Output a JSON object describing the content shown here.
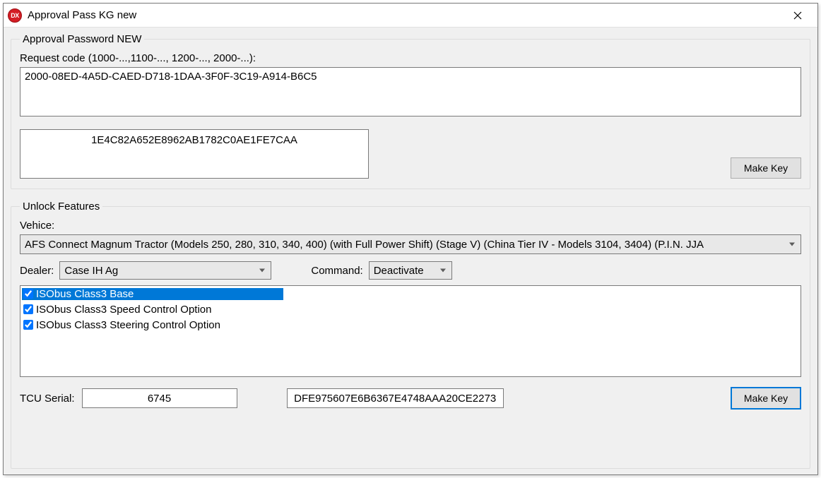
{
  "window": {
    "title": "Approval Pass KG new",
    "icon_text": "DX"
  },
  "group1": {
    "legend": "Approval Password NEW",
    "request_label": "Request code (1000-...,1100-..., 1200-..., 2000-...):",
    "request_value": "2000-08ED-4A5D-CAED-D718-1DAA-3F0F-3C19-A914-B6C5",
    "key_output": "1E4C82A652E8962AB1782C0AE1FE7CAA",
    "make_key_label": "Make Key"
  },
  "group2": {
    "legend": "Unlock Features",
    "vehicle_label": "Vehice:",
    "vehicle_value": "AFS Connect Magnum Tractor (Models 250, 280, 310, 340, 400) (with Full Power Shift) (Stage V) (China Tier IV - Models 3104, 3404) (P.I.N. JJA",
    "dealer_label": "Dealer:",
    "dealer_value": "Case IH Ag",
    "command_label": "Command:",
    "command_value": "Deactivate",
    "features": [
      {
        "label": "ISObus Class3 Base",
        "checked": true,
        "selected": true
      },
      {
        "label": "ISObus Class3 Speed Control Option",
        "checked": true,
        "selected": false
      },
      {
        "label": "ISObus Class3 Steering Control Option",
        "checked": true,
        "selected": false
      }
    ],
    "tcu_label": "TCU Serial:",
    "tcu_value": "6745",
    "tcu_output": "DFE975607E6B6367E4748AAA20CE2273",
    "make_key_label": "Make Key"
  }
}
